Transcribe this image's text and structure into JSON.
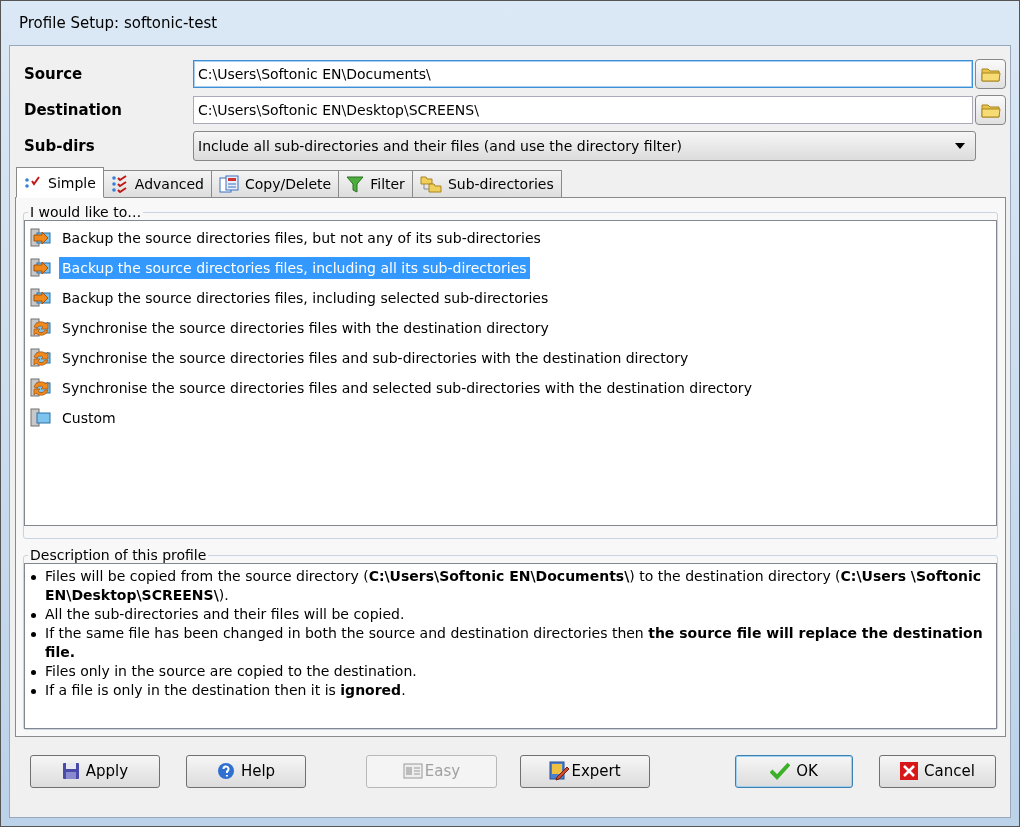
{
  "window": {
    "title": "Profile Setup: softonic-test"
  },
  "fields": [
    {
      "kind": "path",
      "label": "Source",
      "value": "C:\\Users\\Softonic EN\\Documents\\",
      "focused": true
    },
    {
      "kind": "path",
      "label": "Destination",
      "value": "C:\\Users\\Softonic EN\\Desktop\\SCREENS\\",
      "focused": false
    },
    {
      "kind": "dropdown",
      "label": "Sub-dirs",
      "value": "Include all sub-directories and their files (and use the directory filter)"
    }
  ],
  "tabs": [
    {
      "kind": "simple",
      "label": "Simple",
      "selected": true
    },
    {
      "kind": "advanced",
      "label": "Advanced",
      "selected": false
    },
    {
      "kind": "copy",
      "label": "Copy/Delete",
      "selected": false
    },
    {
      "kind": "filter",
      "label": "Filter",
      "selected": false
    },
    {
      "kind": "subdirs",
      "label": "Sub-directories",
      "selected": false
    }
  ],
  "options_group": {
    "title": "I would like to…",
    "items": [
      {
        "kind": "backup",
        "label": "Backup the source directories files, but not any of its sub-directories",
        "selected": false
      },
      {
        "kind": "backup",
        "label": "Backup the source directories files, including all its sub-directories",
        "selected": true
      },
      {
        "kind": "backup",
        "label": "Backup the source directories files, including selected sub-directories",
        "selected": false
      },
      {
        "kind": "sync",
        "label": "Synchronise the source directories files with the destination directory",
        "selected": false
      },
      {
        "kind": "sync",
        "label": "Synchronise the source directories files and sub-directories with the destination directory",
        "selected": false
      },
      {
        "kind": "sync",
        "label": "Synchronise the source directories files and selected sub-directories with the destination directory",
        "selected": false
      },
      {
        "kind": "custom",
        "label": "Custom",
        "selected": false
      }
    ]
  },
  "description": {
    "title": "Description of this profile",
    "items": [
      "Files will be copied from the source directory (**C:\\Users\\Softonic EN\\Documents\\**) to the destination directory (**C:\\Users \\Softonic EN\\Desktop\\SCREENS\\**).",
      "All the sub-directories and their files will be copied.",
      "If the same file has been changed in both the source and destination directories then **the source file will replace the destination file.**",
      "Files only in the source are copied to the destination.",
      "If a file is only in the destination then it is **ignored**."
    ]
  },
  "buttons": [
    {
      "kind": "save",
      "label": "Apply",
      "disabled": false,
      "default": false
    },
    {
      "kind": "help",
      "label": "Help",
      "disabled": false,
      "default": false
    },
    {
      "kind": "easy",
      "label": "Easy",
      "disabled": true,
      "default": false
    },
    {
      "kind": "expert",
      "label": "Expert",
      "disabled": false,
      "default": false
    },
    {
      "kind": "ok",
      "label": "OK",
      "disabled": false,
      "default": true
    },
    {
      "kind": "cancel",
      "label": "Cancel",
      "disabled": false,
      "default": false
    }
  ]
}
